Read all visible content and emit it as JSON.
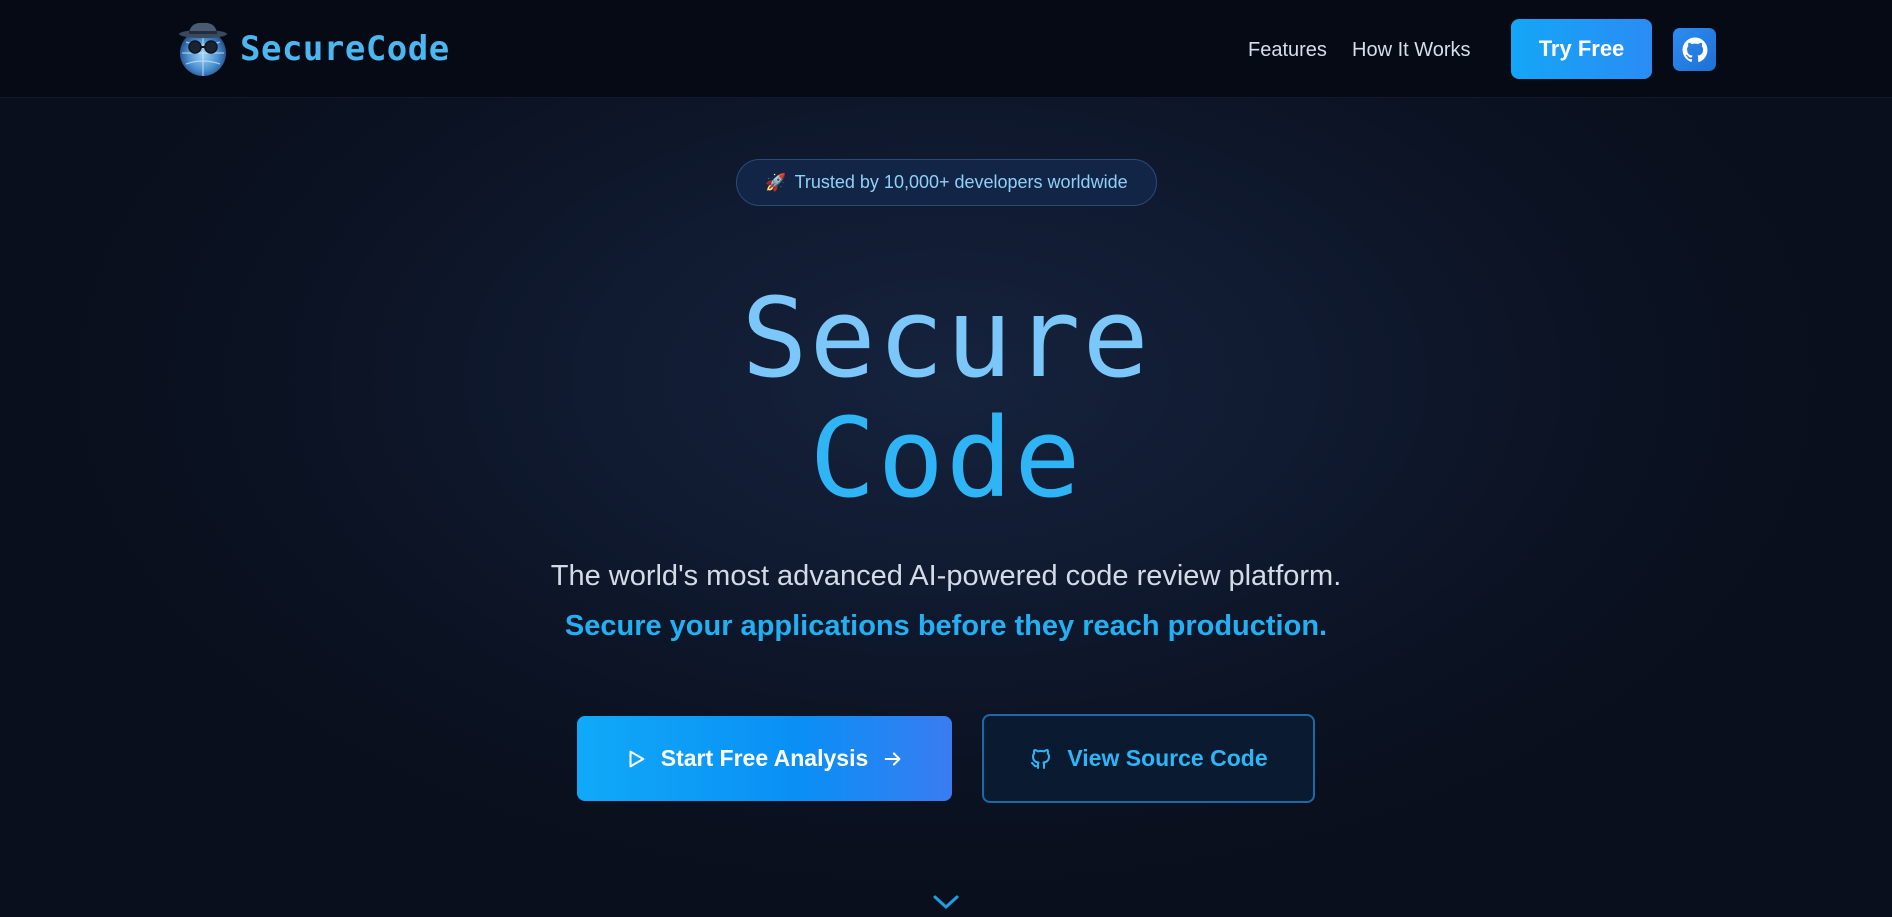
{
  "nav": {
    "logo_text": "SecureCode",
    "links": [
      {
        "label": "Features"
      },
      {
        "label": "How It Works"
      }
    ],
    "try_label": "Try Free",
    "github_icon": "github-icon"
  },
  "hero": {
    "badge_icon": "🚀",
    "badge_text": "Trusted by 10,000+ developers worldwide",
    "title_line1": "Secure",
    "title_line2": "Code",
    "subtitle": "The world's most advanced AI-powered code review platform.",
    "subtitle_highlight": "Secure your applications before they reach production.",
    "primary_cta": "Start Free Analysis",
    "secondary_cta": "View Source Code"
  },
  "colors": {
    "accent": "#22b0f2",
    "title_light": "#7cc7f9",
    "background": "#0a1120",
    "nav_background": "#050a14"
  }
}
